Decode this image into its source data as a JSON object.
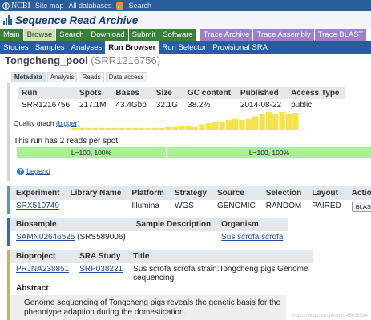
{
  "topbar": {
    "logo": "NCBI",
    "links": [
      "Site map",
      "All databases",
      "Search"
    ]
  },
  "app_title": "Sequence Read Archive",
  "nav": {
    "items": [
      "Main",
      "Browse",
      "Search",
      "Download",
      "Submit",
      "Software"
    ],
    "active": "Browse",
    "trace_items": [
      "Trace Archive",
      "Trace Assembly",
      "Trace BLAST"
    ]
  },
  "subnav": {
    "items": [
      "Studies",
      "Samples",
      "Analyses",
      "Run Browser",
      "Run Selector",
      "Provisional SRA"
    ],
    "active": "Run Browser"
  },
  "run": {
    "name": "Tongcheng_pool",
    "accession": "(SRR1216756)"
  },
  "tabs": [
    "Metadata",
    "Analysis",
    "Reads",
    "Data access"
  ],
  "run_table": {
    "headers": [
      "Run",
      "Spots",
      "Bases",
      "Size",
      "GC content",
      "Published",
      "Access Type"
    ],
    "row": [
      "SRR1216756",
      "217.1M",
      "43.4Gbp",
      "32.1G",
      "38.2%",
      "2014-08-22",
      "public"
    ]
  },
  "quality_graph": {
    "label": "Quality graph",
    "link": "(bigger)",
    "bar_levels": [
      0.1,
      0.1,
      0.1,
      0.1,
      0.1,
      0.1,
      0.1,
      0.1,
      0.1,
      0.1,
      0.1,
      0.1,
      0.1,
      0.1,
      0.15,
      0.15,
      0.2,
      0.2,
      0.15,
      0.3,
      0.35,
      0.45,
      0.45,
      0.55,
      0.6,
      0.55,
      0.6,
      0.75,
      0.9,
      1.0,
      0.9,
      1.0,
      0.9,
      0.95
    ]
  },
  "reads": {
    "text": "This run has 2 reads per spot:",
    "bars": [
      "L=100, 100%",
      "L=100, 100%"
    ]
  },
  "legend_link": "Legend",
  "experiment_table": {
    "headers": [
      "Experiment",
      "Library Name",
      "Platform",
      "Strategy",
      "Source",
      "Selection",
      "Layout",
      "Action"
    ],
    "row": [
      "SRX510749",
      "",
      "Illumina",
      "WGS",
      "GENOMIC",
      "RANDOM",
      "PAIRED",
      "BLAST"
    ]
  },
  "biosample_table": {
    "headers": [
      "Biosample",
      "Sample Description",
      "Organism"
    ],
    "biosample_link": "SAMN02646525",
    "biosample_extra": "(SRS589006)",
    "description": "",
    "organism": "Sus scrofa scrofa"
  },
  "bioproject_table": {
    "headers": [
      "Bioproject",
      "SRA Study",
      "Title"
    ],
    "bioproject": "PRJNA238851",
    "study": "SRP038221",
    "title_line1": "Sus scrofa scrofa strain:Tongcheng pigs Genome",
    "title_line2": "sequencing"
  },
  "abstract": {
    "heading": "Abstract:",
    "line1": "Genome sequencing of Tongcheng pigs reveals the genetic basis for the",
    "line2": "phenotype adaption during the domestication."
  },
  "watermark": "https://blog.csdn.net/m0_45698584",
  "colors": {
    "ncbi_blue": "#2a5d9b",
    "nav_green": "#3b7d3a",
    "trace_purple": "#9a81c8",
    "read_green": "#a8ef96",
    "quality_yellow": "#f4e34a"
  }
}
